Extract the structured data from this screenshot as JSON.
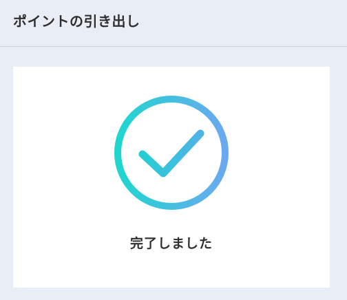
{
  "header": {
    "title": "ポイントの引き出し"
  },
  "result": {
    "icon": "check-circle-icon",
    "message": "完了しました",
    "gradient_start": "#1fd6cf",
    "gradient_end": "#6aa9f0"
  },
  "colors": {
    "background": "#e9edf5",
    "card": "#ffffff",
    "text": "#2f2f2f"
  }
}
